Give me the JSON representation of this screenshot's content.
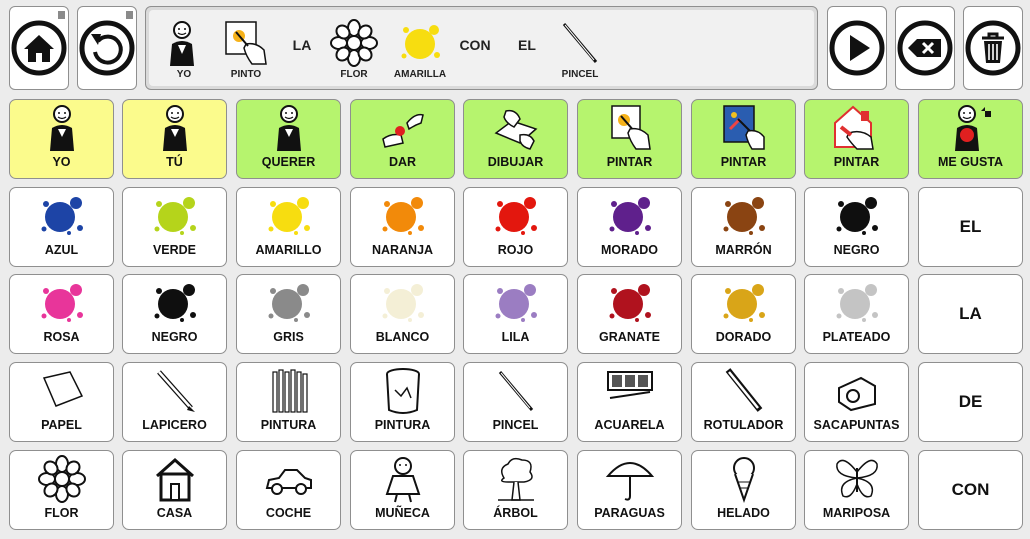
{
  "toolbar": {
    "home": {
      "icon": "home-icon"
    },
    "undo": {
      "icon": "undo-icon"
    },
    "play": {
      "icon": "play-icon"
    },
    "backspace": {
      "icon": "backspace-icon"
    },
    "trash": {
      "icon": "trash-icon"
    }
  },
  "sentence": [
    {
      "label": "YO",
      "icon": "yo-pictogram"
    },
    {
      "label": "PINTO",
      "icon": "pintar-pictogram"
    },
    {
      "label": "LA",
      "icon": null
    },
    {
      "label": "FLOR",
      "icon": "flor-pictogram"
    },
    {
      "label": "AMARILLA",
      "icon": "yellow-paint-pictogram"
    },
    {
      "label": "CON",
      "icon": null
    },
    {
      "label": "EL",
      "icon": null
    },
    {
      "label": "PINCEL",
      "icon": "pincel-pictogram"
    }
  ],
  "grid": {
    "rows": [
      [
        {
          "label": "YO",
          "bg": "yellow",
          "icon": "yo-pictogram"
        },
        {
          "label": "TÚ",
          "bg": "yellow",
          "icon": "tu-pictogram"
        },
        {
          "label": "QUERER",
          "bg": "green",
          "icon": "querer-pictogram"
        },
        {
          "label": "DAR",
          "bg": "green",
          "icon": "dar-pictogram"
        },
        {
          "label": "DIBUJAR",
          "bg": "green",
          "icon": "dibujar-pictogram"
        },
        {
          "label": "PINTAR",
          "bg": "green",
          "icon": "pintar-pictogram"
        },
        {
          "label": "PINTAR",
          "bg": "green",
          "icon": "pintar-canvas-pictogram"
        },
        {
          "label": "PINTAR",
          "bg": "green",
          "icon": "pintar-wall-pictogram"
        },
        {
          "label": "ME GUSTA",
          "bg": "green",
          "icon": "me-gusta-pictogram"
        }
      ],
      [
        {
          "label": "AZUL",
          "color": "#1d44a6"
        },
        {
          "label": "VERDE",
          "color": "#b5d41b"
        },
        {
          "label": "AMARILLO",
          "color": "#f7dd10"
        },
        {
          "label": "NARANJA",
          "color": "#f28a0a"
        },
        {
          "label": "ROJO",
          "color": "#e3170e"
        },
        {
          "label": "MORADO",
          "color": "#5f208c"
        },
        {
          "label": "MARRÓN",
          "color": "#8a4412"
        },
        {
          "label": "NEGRO",
          "color": "#0f0f0f"
        },
        {
          "label": "EL",
          "word": true
        }
      ],
      [
        {
          "label": "ROSA",
          "color": "#e8359a"
        },
        {
          "label": "NEGRO",
          "color": "#0f0f0f"
        },
        {
          "label": "GRIS",
          "color": "#8a8a8a"
        },
        {
          "label": "BLANCO",
          "color": "#f4efd6"
        },
        {
          "label": "LILA",
          "color": "#9b7dc2"
        },
        {
          "label": "GRANATE",
          "color": "#b0121e"
        },
        {
          "label": "DORADO",
          "color": "#d9a518"
        },
        {
          "label": "PLATEADO",
          "color": "#c4c4c4"
        },
        {
          "label": "LA",
          "word": true
        }
      ],
      [
        {
          "label": "PAPEL",
          "icon": "papel-pictogram"
        },
        {
          "label": "LAPICERO",
          "icon": "lapicero-pictogram"
        },
        {
          "label": "PINTURA",
          "icon": "colored-pencils-pictogram"
        },
        {
          "label": "PINTURA",
          "icon": "paint-pot-pictogram"
        },
        {
          "label": "PINCEL",
          "icon": "pincel-pictogram"
        },
        {
          "label": "ACUARELA",
          "icon": "acuarela-pictogram"
        },
        {
          "label": "ROTULADOR",
          "icon": "rotulador-pictogram"
        },
        {
          "label": "SACAPUNTAS",
          "icon": "sacapuntas-pictogram"
        },
        {
          "label": "DE",
          "word": true
        }
      ],
      [
        {
          "label": "FLOR",
          "icon": "flor-pictogram"
        },
        {
          "label": "CASA",
          "icon": "casa-pictogram"
        },
        {
          "label": "COCHE",
          "icon": "coche-pictogram"
        },
        {
          "label": "MUÑECA",
          "icon": "muneca-pictogram"
        },
        {
          "label": "ÁRBOL",
          "icon": "arbol-pictogram"
        },
        {
          "label": "PARAGUAS",
          "icon": "paraguas-pictogram"
        },
        {
          "label": "HELADO",
          "icon": "helado-pictogram"
        },
        {
          "label": "MARIPOSA",
          "icon": "mariposa-pictogram"
        },
        {
          "label": "CON",
          "word": true
        }
      ]
    ]
  }
}
